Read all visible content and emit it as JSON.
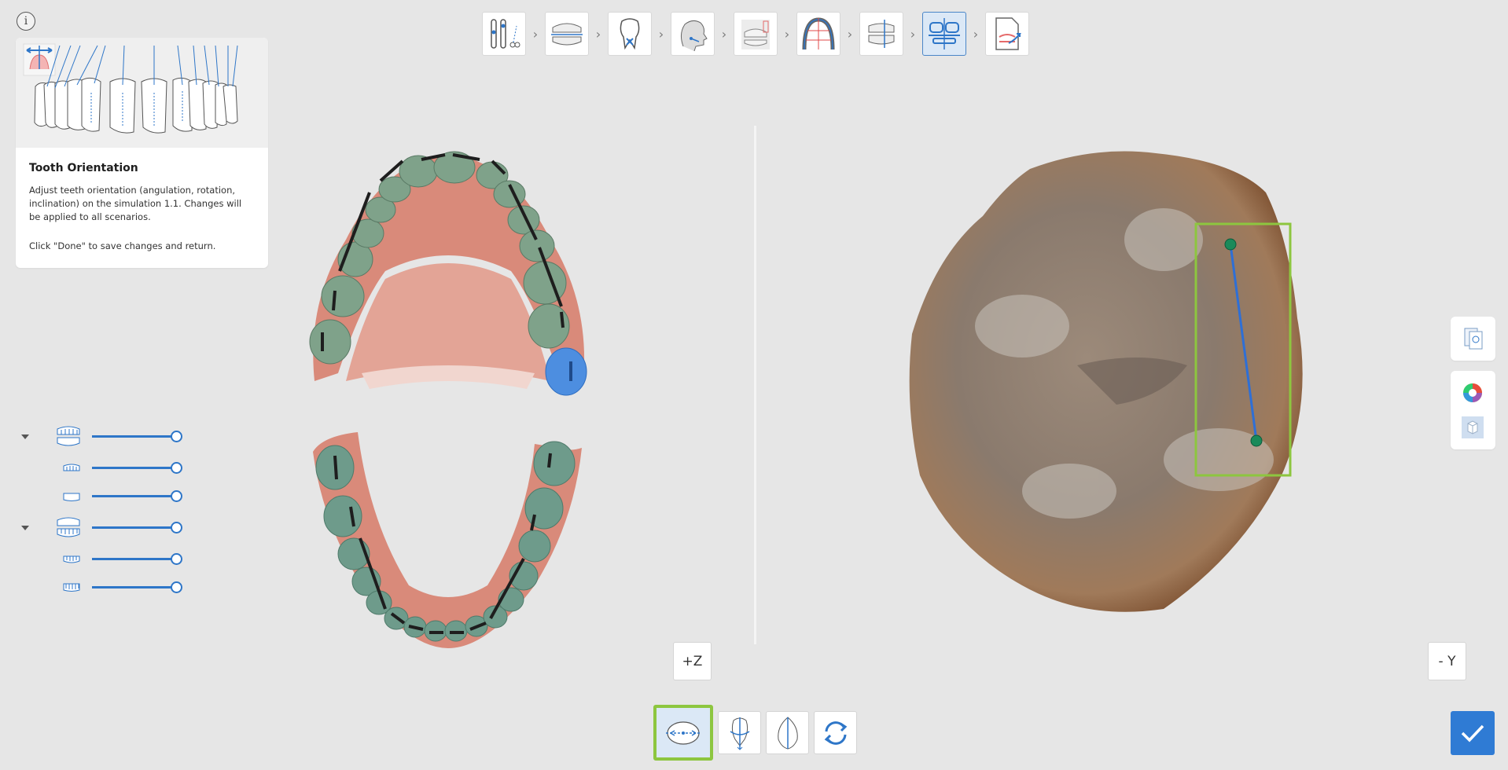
{
  "guide": {
    "title": "Tooth Orientation",
    "description": "Adjust teeth orientation (angulation, rotation, inclination) on the simulation 1.1. Changes will be applied to all scenarios.",
    "done_hint": "Click \"Done\" to save changes and return."
  },
  "workflow": {
    "steps": [
      {
        "name": "segmentation-step",
        "icon": "scissors-tools-icon"
      },
      {
        "name": "bite-step",
        "icon": "jaws-icon"
      },
      {
        "name": "tooth-setup-step",
        "icon": "tooth-icon"
      },
      {
        "name": "face-step",
        "icon": "head-profile-icon"
      },
      {
        "name": "articulation-step",
        "icon": "articulator-icon"
      },
      {
        "name": "arch-step",
        "icon": "arch-icon"
      },
      {
        "name": "staging-step",
        "icon": "staging-icon"
      },
      {
        "name": "orientation-step",
        "icon": "orientation-icon",
        "active": true
      },
      {
        "name": "export-step",
        "icon": "export-icon"
      }
    ]
  },
  "layers": {
    "groups": [
      {
        "name": "upper-jaw",
        "opacity": 1.0,
        "children": [
          {
            "opacity": 1.0
          },
          {
            "opacity": 1.0
          }
        ]
      },
      {
        "name": "lower-jaw",
        "opacity": 1.0,
        "children": [
          {
            "opacity": 1.0
          },
          {
            "opacity": 1.0
          }
        ]
      }
    ]
  },
  "views": {
    "left_axis_label": "+Z",
    "right_axis_label": "- Y"
  },
  "bottom_tools": [
    {
      "name": "angulation-tool",
      "icon": "angulation-icon",
      "active": true
    },
    {
      "name": "rotation-tool",
      "icon": "rotation-axis-icon"
    },
    {
      "name": "inclination-tool",
      "icon": "inclination-icon"
    },
    {
      "name": "reset-tool",
      "icon": "refresh-icon"
    }
  ],
  "colors": {
    "accent": "#2f7bd4",
    "highlight": "#8dc63f",
    "gum": "#d98a7a",
    "tooth": "#7fa28a",
    "selected_tooth": "#4d8ee0"
  }
}
